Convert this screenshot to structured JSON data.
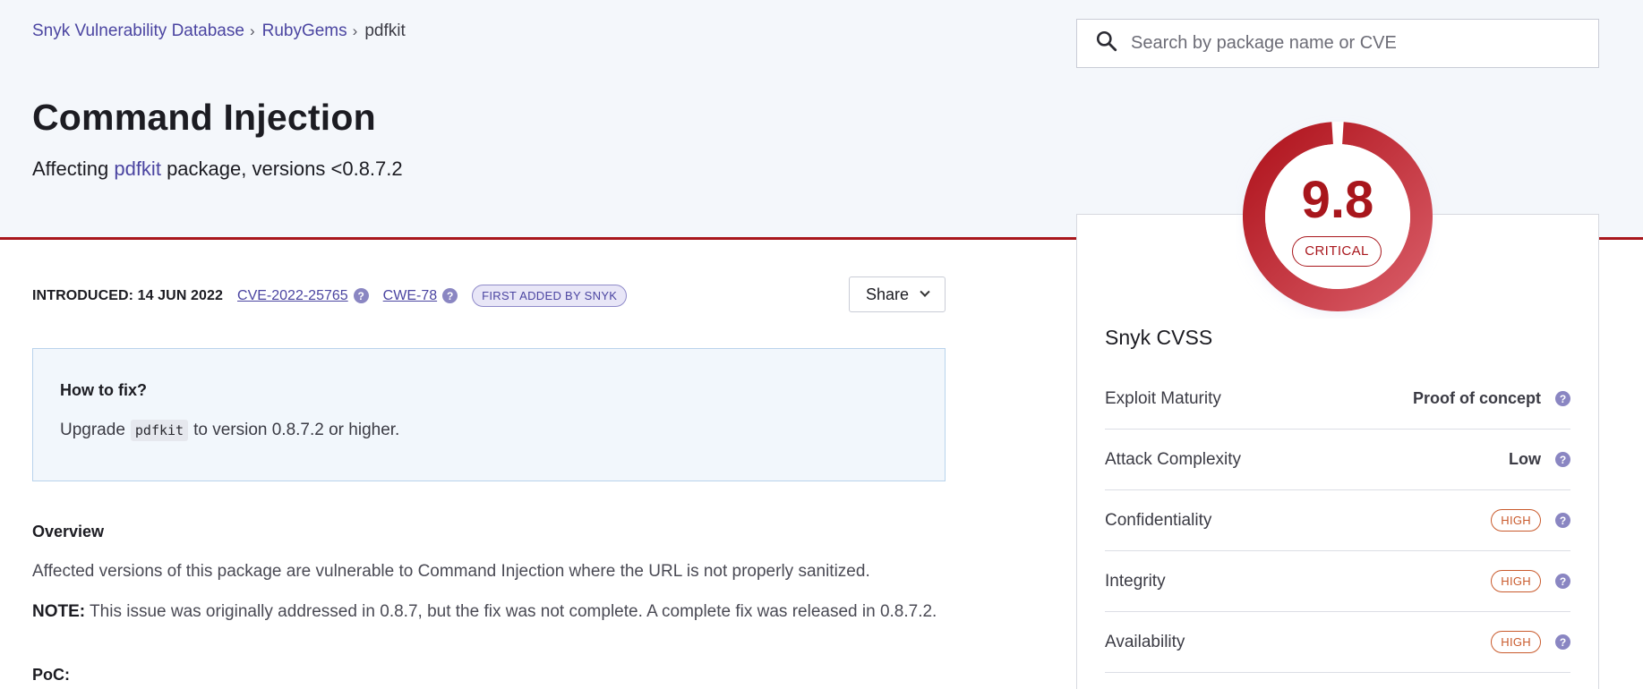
{
  "breadcrumb": {
    "items": [
      "Snyk Vulnerability Database",
      "RubyGems"
    ],
    "separator": "›",
    "current": "pdfkit"
  },
  "search": {
    "placeholder": "Search by package name or CVE",
    "icon": "search-icon"
  },
  "header": {
    "title": "Command Injection",
    "subtitle_prefix": "Affecting",
    "package": "pdfkit",
    "subtitle_suffix": "package, versions <0.8.7.2"
  },
  "meta": {
    "introduced": "INTRODUCED: 14 JUN 2022",
    "cve": "CVE-2022-25765",
    "cwe": "CWE-78",
    "badge": "FIRST ADDED BY SNYK",
    "help_glyph": "?"
  },
  "share": {
    "label": "Share"
  },
  "fix": {
    "heading": "How to fix?",
    "prefix": "Upgrade",
    "code": "pdfkit",
    "suffix": "to version 0.8.7.2 or higher."
  },
  "overview": {
    "heading": "Overview",
    "paragraph": "Affected versions of this package are vulnerable to Command Injection where the URL is not properly sanitized.",
    "note_label": "NOTE:",
    "note_text": "This issue was originally addressed in 0.8.7, but the fix was not complete. A complete fix was released in 0.8.7.2."
  },
  "poc": {
    "heading": "PoC:"
  },
  "score": {
    "value": "9.8",
    "severity": "CRITICAL",
    "fraction": 0.98,
    "color": "#a8161c"
  },
  "cvss": {
    "title": "Snyk CVSS",
    "rows": [
      {
        "label": "Exploit Maturity",
        "value": "Proof of concept",
        "style": "text"
      },
      {
        "label": "Attack Complexity",
        "value": "Low",
        "style": "text"
      },
      {
        "label": "Confidentiality",
        "value": "HIGH",
        "style": "pill"
      },
      {
        "label": "Integrity",
        "value": "HIGH",
        "style": "pill"
      },
      {
        "label": "Availability",
        "value": "HIGH",
        "style": "pill"
      }
    ]
  }
}
